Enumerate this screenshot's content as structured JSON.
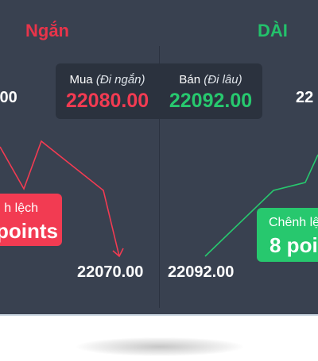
{
  "short": {
    "title": "Ngắn",
    "top_price": ".00",
    "bottom_price": "22070.00",
    "spread_label": "h lệch",
    "spread_value": "points"
  },
  "long": {
    "title": "DÀI",
    "top_price": "22",
    "bottom_price": "22092.00",
    "spread_label": "Chênh lệ",
    "spread_value": "8 poi"
  },
  "quote": {
    "buy": {
      "label": "Mua",
      "hint": "(Đi ngắn)",
      "value": "22080.00"
    },
    "sell": {
      "label": "Bán",
      "hint": "(Đi lâu)",
      "value": "22092.00"
    }
  },
  "colors": {
    "short_red": "#f23b52",
    "long_green": "#27c86e",
    "panel_bg": "#394150"
  }
}
